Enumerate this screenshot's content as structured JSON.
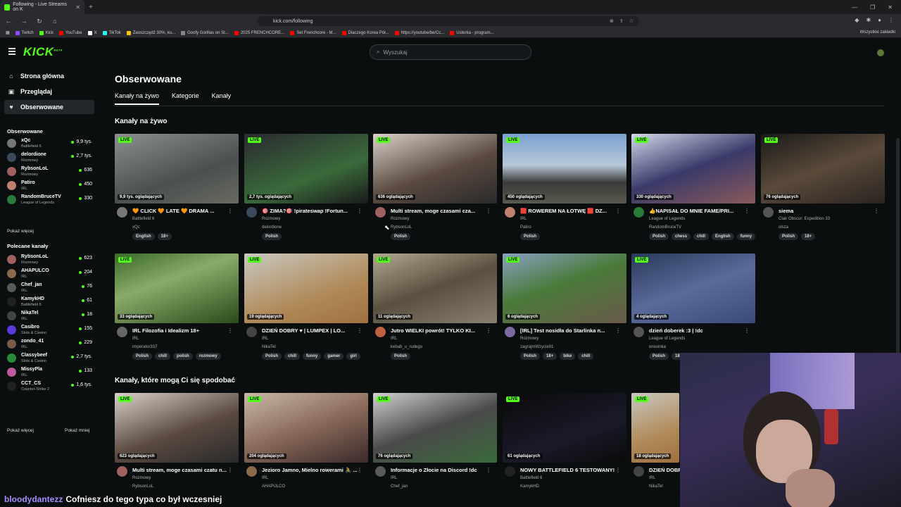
{
  "browser": {
    "tab_title": "Following - Live Streams on K",
    "url": "kick.com/following",
    "bookmarks": [
      "Twitch",
      "Kick",
      "YouTube",
      "X",
      "TikTok",
      "Zaoszczędź 30%, ku...",
      "Goofy Gorillas on St...",
      "2025 FRENCHCORE...",
      "Set Frenchcore - M...",
      "Dlaczego Korea Pół...",
      "https://youtube/be/Cc...",
      "Usterka - program..."
    ],
    "bookmarks_all": "Wszystkie zakładki"
  },
  "header": {
    "logo": "KICK",
    "logo_beta": "BETA",
    "search_placeholder": "Wyszukaj"
  },
  "sidebar": {
    "nav": [
      {
        "label": "Strona główna",
        "icon": "home-icon"
      },
      {
        "label": "Przeglądaj",
        "icon": "browse-icon"
      },
      {
        "label": "Obserwowane",
        "icon": "heart-icon"
      }
    ],
    "following_title": "Obserwowane",
    "following": [
      {
        "name": "xQc",
        "category": "Battlefield 6",
        "viewers": "9,9 tys.",
        "color": "#777"
      },
      {
        "name": "delordione",
        "category": "Rozmowy",
        "viewers": "2,7 tys.",
        "color": "#3a4a5a"
      },
      {
        "name": "RybsonLoL",
        "category": "Rozmowy",
        "viewers": "636",
        "color": "#a06060"
      },
      {
        "name": "Patiro",
        "category": "IRL",
        "viewers": "450",
        "color": "#c08070"
      },
      {
        "name": "RandomBruceTV",
        "category": "League of Legends",
        "viewers": "330",
        "color": "#2a7a3a"
      }
    ],
    "show_more_1": "Pokaż więcej",
    "recommended_title": "Polecane kanały",
    "recommended": [
      {
        "name": "RybsonLoL",
        "category": "Rozmowy",
        "viewers": "623",
        "color": "#a06060"
      },
      {
        "name": "AHAPULCO",
        "category": "IRL",
        "viewers": "204",
        "color": "#8a6a4a"
      },
      {
        "name": "Chef_jan",
        "category": "IRL",
        "viewers": "76",
        "color": "#5a5a5a"
      },
      {
        "name": "KamykHD",
        "category": "Battlefield 6",
        "viewers": "61",
        "color": "#222"
      },
      {
        "name": "NikaTel",
        "category": "IRL",
        "viewers": "18",
        "color": "#444"
      },
      {
        "name": "Casibro",
        "category": "Slots & Casino",
        "viewers": "155",
        "color": "#5a3ad8"
      },
      {
        "name": "zondo_41",
        "category": "IRL",
        "viewers": "229",
        "color": "#7a5a4a"
      },
      {
        "name": "Classybeef",
        "category": "Slots & Casino",
        "viewers": "2,7 tys.",
        "color": "#2a8a3a"
      },
      {
        "name": "MissyPla",
        "category": "IRL",
        "viewers": "133",
        "color": "#c05a9a"
      },
      {
        "name": "CCT_CS",
        "category": "Counter-Strike 2",
        "viewers": "1,6 tys.",
        "color": "#222"
      }
    ],
    "show_more_2": "Pokaż więcej",
    "show_less": "Pokaż mniej"
  },
  "main": {
    "title": "Obserwowane",
    "tabs": [
      "Kanały na żywo",
      "Kategorie",
      "Kanały"
    ],
    "section_live": "Kanały na żywo",
    "section_suggest": "Kanały, które mogą Ci się spodobać",
    "live_label": "LIVE",
    "row1": [
      {
        "viewers": "9,9 tys. oglądających",
        "title": "🧡 CLICK 🧡 LATE 🧡 DRAMA ...",
        "category": "Battlefield 6",
        "channel": "xQc",
        "tags": [
          "English",
          "18+"
        ],
        "bg": "linear-gradient(160deg,#8a9090,#4a5050 60%,#6a6a60)",
        "av": "#777"
      },
      {
        "viewers": "2,7 tys. oglądających",
        "title": "🎯 ZIMA?🎯 !pirateswap !Fortun...",
        "category": "Rozmowy",
        "channel": "delordione",
        "tags": [
          "Polish"
        ],
        "bg": "linear-gradient(160deg,#2a2a30,#3a6a3a 60%,#1a1a1a)",
        "av": "#3a4a5a"
      },
      {
        "viewers": "636 oglądających",
        "title": "Multi stream, moge czasami cza...",
        "category": "Rozmowy",
        "channel": "RybsonLoL",
        "tags": [
          "Polish"
        ],
        "bg": "linear-gradient(160deg,#d8d0c8,#5a4a40 55%,#2a2a2a)",
        "av": "#a06060"
      },
      {
        "viewers": "450 oglądających",
        "title": "🟥 ROWEREM NA ŁOTWĘ 🟥 DZ...",
        "category": "IRL",
        "channel": "Patiro",
        "tags": [
          "Polish"
        ],
        "bg": "linear-gradient(180deg,#7aa0d0,#b8c8d8 45%,#3a3a38 70%,#5a5a50)",
        "av": "#c08070"
      },
      {
        "viewers": "330 oglądających",
        "title": "👍NAPISAŁ DO MNIE FAME/PRI...",
        "category": "League of Legends",
        "channel": "RandomBruceTV",
        "tags": [
          "Polish",
          "chess",
          "chill",
          "English",
          "funny"
        ],
        "bg": "linear-gradient(160deg,#d0d8e8,#3a3a6a 50%,#8a5a5a)",
        "av": "#2a7a3a"
      },
      {
        "viewers": "76 oglądających",
        "title": "siema",
        "category": "Clair Obscur: Expedition 33",
        "channel": "olsza",
        "tags": [
          "Polish",
          "18+"
        ],
        "bg": "linear-gradient(160deg,#1a1a18,#5a4a3a 50%,#2a2420)",
        "av": "#555"
      }
    ],
    "row2": [
      {
        "viewers": "33 oglądających",
        "title": "IRL Filozofia i Idealizm 18+",
        "category": "IRL",
        "channel": "imperator337",
        "tags": [
          "Polish",
          "chill",
          "polish",
          "rozmowy"
        ],
        "bg": "linear-gradient(160deg,#3a6a2a,#8aaa6a 40%,#2a4a1a)",
        "av": "#666"
      },
      {
        "viewers": "19 oglądających",
        "title": "DZIEŃ DOBRY ♥ | LUMPEX | LO...",
        "category": "IRL",
        "channel": "NikaTel",
        "tags": [
          "Polish",
          "chill",
          "funny",
          "gamer",
          "girl"
        ],
        "bg": "linear-gradient(160deg,#c8c8c0,#b08a5a 60%,#a07040)",
        "av": "#444"
      },
      {
        "viewers": "11 oglądających",
        "title": "Jutro WIELKI powrót! TYLKO KI...",
        "category": "IRL",
        "channel": "kebab_u_rudego",
        "tags": [
          "Polish"
        ],
        "bg": "linear-gradient(160deg,#b0a890,#5a5040 50%,#8a8070)",
        "av": "#c06040"
      },
      {
        "viewers": "6 oglądających",
        "title": "[IRL] Test nosidła do Starlinka n...",
        "category": "Rozmowy",
        "channel": "zagrajmWzycie91",
        "tags": [
          "Polish",
          "18+",
          "bike",
          "chill"
        ],
        "bg": "linear-gradient(160deg,#8aa0c0,#4a7a3a 45%,#6a5a4a)",
        "av": "#7a6aa0"
      },
      {
        "viewers": "4 oglądających",
        "title": "dzień doberek :3 | !dc",
        "category": "League of Legends",
        "channel": "wreoinka",
        "tags": [
          "Polish",
          "18+"
        ],
        "bg": "linear-gradient(160deg,#2a3a5a,#5a6a9a 50%,#3a4a7a)",
        "av": "#555"
      }
    ],
    "row3": [
      {
        "viewers": "623 oglądających",
        "title": "Multi stream, moge czasami czatu n...",
        "category": "Rozmowy",
        "channel": "RybsonLoL",
        "bg": "linear-gradient(160deg,#d8d0c8,#5a4a40 55%,#2a2a2a)",
        "av": "#a06060"
      },
      {
        "viewers": "204 oglądających",
        "title": "Jezioro Jamno, Mielno rowerami 🚴 ...",
        "category": "IRL",
        "channel": "AHAPULCO",
        "bg": "linear-gradient(160deg,#c8b8a8,#8a6a5a 50%,#3a2a2a)",
        "av": "#8a6a4a"
      },
      {
        "viewers": "76 oglądających",
        "title": "Informacje o Złocie na Discord !dc",
        "category": "IRL",
        "channel": "Chef_jan",
        "bg": "linear-gradient(160deg,#d0d0d0,#4a4a4a 50%,#3a6a3a)",
        "av": "#5a5a5a"
      },
      {
        "viewers": "61 oglądających",
        "title": "NOWY BATTLEFIELD 6 TESTOWANY!",
        "category": "Battlefield 6",
        "channel": "KamykHD",
        "bg": "linear-gradient(160deg,#0a0a0a,#1a1a2a 60%,#0a0a0a)",
        "av": "#222"
      },
      {
        "viewers": "18 oglądających",
        "title": "DZIEŃ DOBRY",
        "category": "IRL",
        "channel": "NikaTel",
        "bg": "linear-gradient(160deg,#c8c8c0,#b08a5a 60%,#a07040)",
        "av": "#444"
      }
    ]
  },
  "chat": {
    "user": "bloodydantezz",
    "message": "Cofniesz do tego typa co był wczesniej"
  }
}
